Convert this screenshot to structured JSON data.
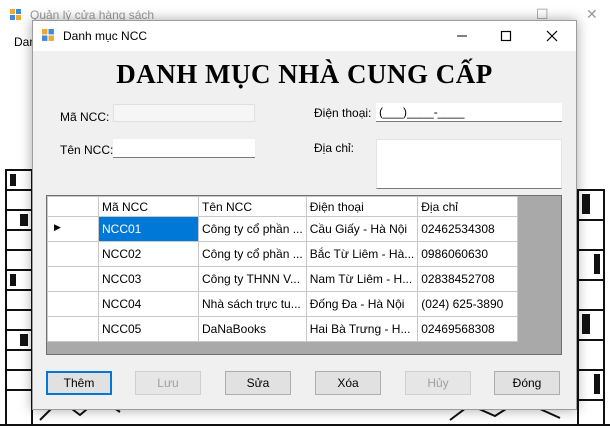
{
  "parent_window": {
    "title": "Quản lý cửa hàng sách",
    "menu_label": "Dan"
  },
  "dialog": {
    "title": "Danh mục NCC",
    "heading": "DANH MỤC NHÀ CUNG CẤP"
  },
  "form": {
    "ma_ncc_label": "Mã NCC:",
    "ma_ncc_value": "",
    "ten_ncc_label": "Tên NCC:",
    "ten_ncc_value": "",
    "dien_thoai_label": "Điện thoại:",
    "dien_thoai_value": "(___)____-____",
    "dia_chi_label": "Địa chỉ:",
    "dia_chi_value": ""
  },
  "grid": {
    "columns": [
      "Mã NCC",
      "Tên NCC",
      "Điện thoại",
      "Địa chỉ"
    ],
    "rows": [
      [
        "NCC01",
        "Công ty cổ phần ...",
        "Cầu Giấy - Hà Nội",
        "02462534308"
      ],
      [
        "NCC02",
        "Công ty cổ phần ...",
        "Bắc Từ Liêm - Hà...",
        "0986060630"
      ],
      [
        "NCC03",
        "Công ty THNN V...",
        "Nam Từ Liêm - H...",
        "02838452708"
      ],
      [
        "NCC04",
        "Nhà sách trực tu...",
        "Đống Đa - Hà Nội",
        "(024) 625-3890"
      ],
      [
        "NCC05",
        "DaNaBooks",
        "Hai Bà Trưng - H...",
        "02469568308"
      ]
    ],
    "selected_row": 0,
    "current_row_marker": "▶"
  },
  "buttons": {
    "them": "Thêm",
    "luu": "Lưu",
    "sua": "Sửa",
    "xoa": "Xóa",
    "huy": "Hủy",
    "dong": "Đóng"
  },
  "colors": {
    "selection": "#0078d7",
    "grid_background": "#a9a9a9",
    "dialog_background": "#f0f0f0"
  }
}
